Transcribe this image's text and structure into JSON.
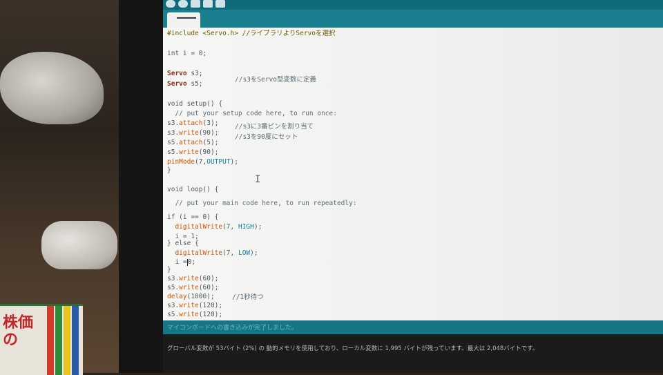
{
  "window": {
    "tab_title": ""
  },
  "colors": {
    "toolbar": "#0f6b7a",
    "tabbar": "#1a7f8e",
    "editor_bg": "#f1f2f0",
    "console_bg": "#1b1b1b",
    "keyword": "#cc6600",
    "type": "#8a2a1c",
    "constant": "#0f7fa0"
  },
  "icons": [
    "verify-icon",
    "upload-icon",
    "new-icon",
    "open-icon",
    "save-icon"
  ],
  "code": {
    "l01": "#include <Servo.h> //ライブラリよりServoを選択",
    "l02": "int i = 0;",
    "l03_type": "Servo",
    "l03_rest": " s3;",
    "l03_comment": "//s3をServo型変数に定義",
    "l04_type": "Servo",
    "l04_rest": " s5;",
    "l05": "void setup() {",
    "l06": "  // put your setup code here, to run once:",
    "l07_obj": "s3.",
    "l07_fn": "attach",
    "l07_rest": "(3);",
    "l07_comment": "//s3に3番ピンを割り当て",
    "l08_obj": "s3.",
    "l08_fn": "write",
    "l08_rest": "(90);",
    "l08_comment": "//s3を90度にセット",
    "l09_obj": "s5.",
    "l09_fn": "attach",
    "l09_rest": "(5);",
    "l10_obj": "s5.",
    "l10_fn": "write",
    "l10_rest": "(90);",
    "l11_fn": "pinMode",
    "l11_a": "(7,",
    "l11_const": "OUTPUT",
    "l11_b": ");",
    "l12": "}",
    "l13": "void loop() {",
    "l14": "  // put your main code here, to run repeatedly:",
    "l15": "if (i == 0) {",
    "l16_fn": "  digitalWrite",
    "l16_a": "(7, ",
    "l16_const": "HIGH",
    "l16_b": ");",
    "l17": "  i = 1;",
    "l18": "} else {",
    "l19_fn": "  digitalWrite",
    "l19_a": "(7, ",
    "l19_const": "LOW",
    "l19_b": ");",
    "l20_a": "  i =",
    "l20_b": "0;",
    "l21": "}",
    "l22_obj": "s3.",
    "l22_fn": "write",
    "l22_rest": "(60);",
    "l23_obj": "s5.",
    "l23_fn": "write",
    "l23_rest": "(60);",
    "l24_fn": "delay",
    "l24_rest": "(1000);",
    "l24_comment": "//1秒待つ",
    "l25_obj": "s3.",
    "l25_fn": "write",
    "l25_rest": "(120);",
    "l26_obj": "s5.",
    "l26_fn": "write",
    "l26_rest": "(120);"
  },
  "status": {
    "message": "マイコンボードへの書き込みが完了しました。"
  },
  "console": {
    "message": "グローバル変数が 53バイト (2%) の 動的メモリを使用しており、ローカル変数に 1,995 バイトが残っています。最大は 2,048バイトです。"
  },
  "background": {
    "book_title": "株価の"
  }
}
